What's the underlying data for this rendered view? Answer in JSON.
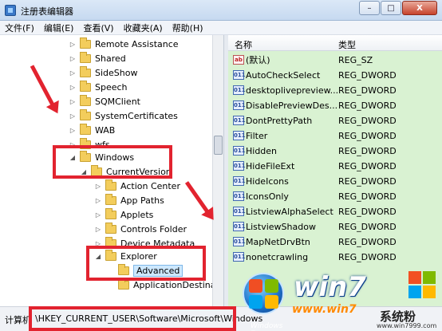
{
  "window": {
    "title": "注册表编辑器",
    "buttons": {
      "minimize": "–",
      "maximize": "□",
      "close": "X"
    }
  },
  "menu": [
    "文件(F)",
    "编辑(E)",
    "查看(V)",
    "收藏夹(A)",
    "帮助(H)"
  ],
  "tree": {
    "items": [
      {
        "label": "Remote Assistance",
        "expander": "▷"
      },
      {
        "label": "Shared",
        "expander": "▷"
      },
      {
        "label": "SideShow",
        "expander": "▷"
      },
      {
        "label": "Speech",
        "expander": "▷"
      },
      {
        "label": "SQMClient",
        "expander": "▷"
      },
      {
        "label": "SystemCertificates",
        "expander": "▷"
      },
      {
        "label": "WAB",
        "expander": "▷"
      },
      {
        "label": "wfs",
        "expander": "▷"
      },
      {
        "label": "Windows",
        "expander": "◢"
      },
      {
        "label": "CurrentVersion",
        "expander": "◢"
      },
      {
        "label": "Action Center",
        "expander": "▷"
      },
      {
        "label": "App Paths",
        "expander": "▷"
      },
      {
        "label": "Applets",
        "expander": "▷"
      },
      {
        "label": "Controls Folder",
        "expander": "▷"
      },
      {
        "label": "Device Metadata",
        "expander": "▷"
      },
      {
        "label": "Explorer",
        "expander": "◢"
      },
      {
        "label": "Advanced",
        "expander": ""
      },
      {
        "label": "ApplicationDestinati",
        "expander": ""
      }
    ]
  },
  "list": {
    "headers": {
      "name": "名称",
      "type": "类型"
    },
    "rows": [
      {
        "name": "(默认)",
        "type": "REG_SZ",
        "icon": "ab"
      },
      {
        "name": "AutoCheckSelect",
        "type": "REG_DWORD",
        "icon": "011"
      },
      {
        "name": "desktoplivepreview...",
        "type": "REG_DWORD",
        "icon": "011"
      },
      {
        "name": "DisablePreviewDes...",
        "type": "REG_DWORD",
        "icon": "011"
      },
      {
        "name": "DontPrettyPath",
        "type": "REG_DWORD",
        "icon": "011"
      },
      {
        "name": "Filter",
        "type": "REG_DWORD",
        "icon": "011"
      },
      {
        "name": "Hidden",
        "type": "REG_DWORD",
        "icon": "011"
      },
      {
        "name": "HideFileExt",
        "type": "REG_DWORD",
        "icon": "011"
      },
      {
        "name": "HideIcons",
        "type": "REG_DWORD",
        "icon": "011"
      },
      {
        "name": "IconsOnly",
        "type": "REG_DWORD",
        "icon": "011"
      },
      {
        "name": "ListviewAlphaSelect",
        "type": "REG_DWORD",
        "icon": "011"
      },
      {
        "name": "ListviewShadow",
        "type": "REG_DWORD",
        "icon": "011"
      },
      {
        "name": "MapNetDrvBtn",
        "type": "REG_DWORD",
        "icon": "011"
      },
      {
        "name": "nonetcrawling",
        "type": "REG_DWORD",
        "icon": "011"
      }
    ]
  },
  "status": {
    "label": "计算机",
    "path": "\\HKEY_CURRENT_USER\\Software\\Microsoft\\Windows"
  },
  "watermark": {
    "logo_text": "Windows 7",
    "title": "win7",
    "url": "www.win7",
    "brand": "系统粉",
    "brand_url": "www.win7999.com"
  },
  "colors": {
    "annotation": "#e2232f",
    "list_highlight": "#d9f2d2"
  }
}
